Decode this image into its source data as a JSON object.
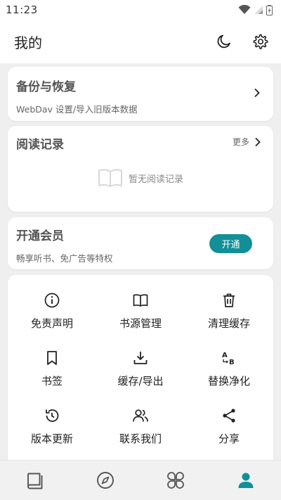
{
  "status_bar": {
    "time": "11:23"
  },
  "app_bar": {
    "title": "我的"
  },
  "backup_card": {
    "title": "备份与恢复",
    "subtitle": "WebDav 设置/导入旧版本数据"
  },
  "reading_card": {
    "title": "阅读记录",
    "more": "更多",
    "empty": "暂无阅读记录"
  },
  "member_card": {
    "title": "开通会员",
    "subtitle": "畅享听书、免广告等特权",
    "button": "开通"
  },
  "grid": {
    "items": [
      {
        "label": "免责声明",
        "icon": "info-icon"
      },
      {
        "label": "书源管理",
        "icon": "book-open-icon"
      },
      {
        "label": "清理缓存",
        "icon": "trash-icon"
      },
      {
        "label": "书签",
        "icon": "bookmark-icon"
      },
      {
        "label": "缓存/导出",
        "icon": "download-icon"
      },
      {
        "label": "替换净化",
        "icon": "replace-ab-icon"
      },
      {
        "label": "版本更新",
        "icon": "history-icon"
      },
      {
        "label": "联系我们",
        "icon": "users-icon"
      },
      {
        "label": "分享",
        "icon": "share-icon"
      }
    ]
  },
  "bottom_nav": {
    "items": [
      {
        "name": "bookshelf",
        "icon": "bookshelf-icon"
      },
      {
        "name": "discover",
        "icon": "compass-icon"
      },
      {
        "name": "categories",
        "icon": "clover-icon"
      },
      {
        "name": "profile",
        "icon": "person-icon",
        "active": true
      }
    ]
  },
  "colors": {
    "accent": "#138f97",
    "inactive_icon": "#555555",
    "background": "#efefef"
  }
}
